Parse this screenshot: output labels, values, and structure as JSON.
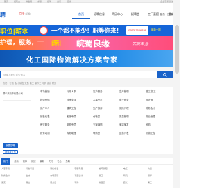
{
  "topbar": {
    "links": [
      "首页",
      "招聘会",
      "精品网",
      "求职",
      "招聘",
      "资讯",
      "培训"
    ],
    "right": "企业登录 微信关注"
  },
  "header": {
    "logo": "聘",
    "city": "包头",
    "city_sub": "[切换]",
    "nav": [
      "首页",
      "招聘信息",
      "简历中心",
      "招聘会",
      "工厂直招",
      "看新"
    ],
    "user": "登录 | 注册"
  },
  "banners": {
    "b1_left": "职位|薪水",
    "b1_mid": "一个都不能少！职等你来！",
    "b1_phone": "0553-3526336",
    "b1_right": "最新一期",
    "b2_left": "护理，服务，一",
    "b2_mid": "|来|",
    "b2_big": "皖蜀良缘",
    "b2_right": "优质单身",
    "b3": "化工国际物流解决方案专家"
  },
  "search": {
    "placeholder": "请输入职位或公司名"
  },
  "hot": "热门：行政 会计 销售 文员 普工 操作工 司机 设计 财务",
  "side": {
    "company": "鄂尔多斯市有限公司",
    "btn_primary": "我要招聘",
    "btn_secondary": "我要找工作"
  },
  "grid": [
    "市场营销",
    "行政人事",
    "客户服务",
    "生产管理",
    "普工/操工",
    "物流仓储",
    "技术支持",
    "人事专员",
    "电子商务",
    "设计师",
    "房产中介",
    "建筑工程",
    "生产操作",
    "保险代理",
    "财务会计",
    "销售代表",
    "客服专员",
    "仓管员",
    "质量管理",
    "物业管理",
    "餐饮服务",
    "采购专员",
    "文案编辑",
    "美容美发",
    "司机",
    "教育培训",
    "商务助理",
    "导购员",
    "医药代表",
    "机械工程"
  ],
  "bottom": {
    "tabs": [
      "热门",
      "最新",
      "推荐",
      "热招",
      "兼职",
      "实习",
      "名企",
      "急聘"
    ],
    "rows": [
      "人事专员",
      "行政专员",
      "销售代表",
      "客服专员",
      "仓库管理",
      "电工",
      "文员",
      "财务会计",
      "出纳",
      "市场营销",
      "平面设计",
      "普工",
      "司机",
      "厨师",
      "保安",
      "保洁",
      "服务员",
      "导购",
      "收银员",
      "店长",
      "美工"
    ]
  },
  "colors": {
    "accent": "#1a63c9",
    "banner_blue": "#1565d8",
    "banner_pink": "#ff6fa8"
  }
}
